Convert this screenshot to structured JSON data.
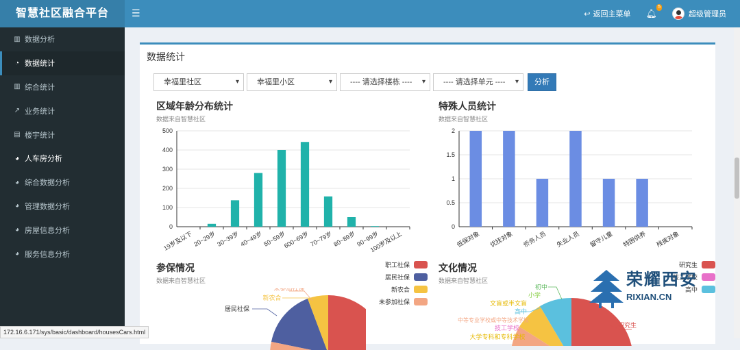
{
  "app": {
    "title": "智慧社区融合平台"
  },
  "header": {
    "back_label": "返回主菜单",
    "notif_count": "5",
    "user_name": "超级管理员"
  },
  "sidebar": {
    "items": [
      {
        "label": "数据分析",
        "icon": "bar-chart-icon"
      },
      {
        "label": "数据统计",
        "icon": "pie-chart-icon"
      },
      {
        "label": "综合统计",
        "icon": "bar-chart-icon"
      },
      {
        "label": "业务统计",
        "icon": "line-chart-icon"
      },
      {
        "label": "楼宇统计",
        "icon": "building-icon"
      },
      {
        "label": "人车房分析",
        "icon": "dashboard-icon"
      },
      {
        "label": "综合数据分析",
        "icon": "dashboard-icon"
      },
      {
        "label": "管理数据分析",
        "icon": "dashboard-icon"
      },
      {
        "label": "房屋信息分析",
        "icon": "dashboard-icon"
      },
      {
        "label": "服务信息分析",
        "icon": "dashboard-icon"
      }
    ]
  },
  "panel": {
    "title": "数据统计"
  },
  "filters": {
    "community": "幸福里社区",
    "estate": "幸福里小区",
    "building": "---- 请选择楼栋 ----",
    "unit": "---- 请选择单元 ----",
    "submit": "分析"
  },
  "charts": {
    "age": {
      "title": "区域年龄分布统计",
      "subtitle": "数据来自智慧社区"
    },
    "special": {
      "title": "特殊人员统计",
      "subtitle": "数据来自智慧社区"
    },
    "insurance": {
      "title": "参保情况",
      "subtitle": "数据来自智慧社区"
    },
    "education": {
      "title": "文化情况",
      "subtitle": "数据来自智慧社区"
    }
  },
  "chart_data": [
    {
      "type": "bar",
      "title": "区域年龄分布统计",
      "categories": [
        "19岁及以下",
        "20~29岁",
        "30~39岁",
        "40~49岁",
        "50~59岁",
        "600~69岁",
        "70~79岁",
        "80~89岁",
        "90~99岁",
        "100岁及以上"
      ],
      "values": [
        0,
        15,
        138,
        280,
        400,
        442,
        158,
        50,
        3,
        0
      ],
      "ylim": [
        0,
        500
      ],
      "yticks": [
        "0",
        "100",
        "200",
        "300",
        "400",
        "500"
      ],
      "color": "#20b2aa"
    },
    {
      "type": "bar",
      "title": "特殊人员统计",
      "categories": [
        "低保对象",
        "优抚对象",
        "侨务人员",
        "失业人员",
        "留守儿童",
        "特困供养",
        "残疾对象"
      ],
      "values": [
        2,
        2,
        1,
        2,
        1,
        1,
        0
      ],
      "ylim": [
        0,
        2
      ],
      "yticks": [
        "0",
        "0.5",
        "1",
        "1.5",
        "2"
      ],
      "color": "#6b8de3"
    },
    {
      "type": "pie",
      "title": "参保情况",
      "legend": [
        {
          "name": "职工社保",
          "color": "#d9534f"
        },
        {
          "name": "居民社保",
          "color": "#4e5fa0"
        },
        {
          "name": "新农合",
          "color": "#f5c342"
        },
        {
          "name": "未参加社保",
          "color": "#f3a683"
        }
      ],
      "visible_labels": [
        "未参加社保",
        "新农合",
        "居民社保"
      ]
    },
    {
      "type": "pie",
      "title": "文化情况",
      "legend": [
        {
          "name": "研究生",
          "color": "#d9534f"
        },
        {
          "name": "技工学校",
          "color": "#e870c9"
        },
        {
          "name": "高中",
          "color": "#5bc0de"
        }
      ],
      "visible_labels": [
        "初中",
        "小学",
        "文盲或半文盲",
        "高中",
        "中等专业学校或中等技术学校",
        "技工学校",
        "大学专科和专科学校",
        "研究生"
      ]
    }
  ],
  "watermark": {
    "text": "荣耀西安",
    "url": "RIXIAN.CN"
  },
  "statusbar": {
    "url": "172.16.6.171/sys/basic/dashboard/housesCars.html"
  }
}
